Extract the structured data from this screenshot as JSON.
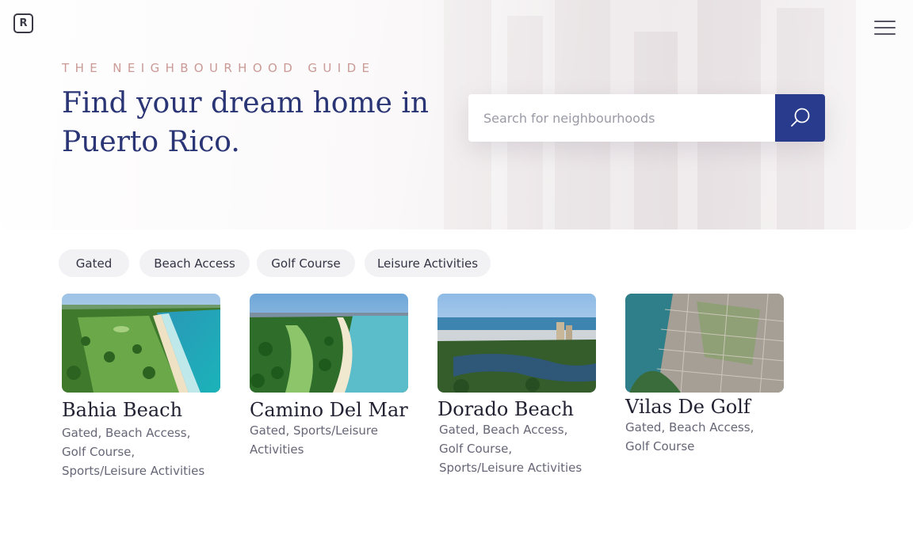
{
  "header": {
    "logo_letter": "R",
    "eyebrow": "THE NEIGHBOURHOOD GUIDE",
    "headline": "Find your dream home in Puerto Rico."
  },
  "search": {
    "placeholder": "Search for neighbourhoods",
    "value": ""
  },
  "filters": [
    "Gated",
    "Beach Access",
    "Golf Course",
    "Leisure Activities"
  ],
  "neighbourhoods": [
    {
      "name": "Bahia Beach",
      "tags": "Gated, Beach Access, Golf Course, Sports/Leisure Activities"
    },
    {
      "name": "Camino Del Mar",
      "tags": "Gated, Sports/Leisure Activities"
    },
    {
      "name": "Dorado Beach",
      "tags": "Gated, Beach Access, Golf Course, Sports/Leisure Activities"
    },
    {
      "name": "Vilas De Golf",
      "tags": "Gated, Beach Access, Golf Course"
    }
  ],
  "colors": {
    "accent": "#283b8d",
    "headline": "#2a3575",
    "eyebrow": "#c99a96",
    "chip_bg": "#f2f2f4"
  },
  "icons": {
    "logo": "logo-icon",
    "menu": "hamburger-menu-icon",
    "search": "search-icon"
  }
}
